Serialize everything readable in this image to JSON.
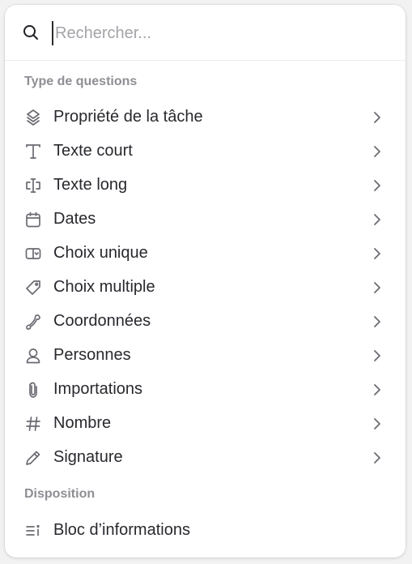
{
  "search": {
    "placeholder": "Rechercher..."
  },
  "sections": [
    {
      "title": "Type de questions",
      "items": [
        {
          "label": "Propriété de la tâche",
          "icon": "stack-layers-icon"
        },
        {
          "label": "Texte court",
          "icon": "text-t-icon"
        },
        {
          "label": "Texte long",
          "icon": "text-cursor-box-icon"
        },
        {
          "label": "Dates",
          "icon": "calendar-icon"
        },
        {
          "label": "Choix unique",
          "icon": "dropdown-select-icon"
        },
        {
          "label": "Choix multiple",
          "icon": "tag-icon"
        },
        {
          "label": "Coordonnées",
          "icon": "phone-icon"
        },
        {
          "label": "Personnes",
          "icon": "person-icon"
        },
        {
          "label": "Importations",
          "icon": "paperclip-icon"
        },
        {
          "label": "Nombre",
          "icon": "hash-icon"
        },
        {
          "label": "Signature",
          "icon": "pencil-icon"
        }
      ]
    },
    {
      "title": "Disposition",
      "items": [
        {
          "label": "Bloc d’informations",
          "icon": "info-list-icon"
        }
      ]
    }
  ],
  "colors": {
    "text": "#28282e",
    "muted": "#8e8e94",
    "icon": "#6b6b72",
    "background": "#ffffff"
  }
}
